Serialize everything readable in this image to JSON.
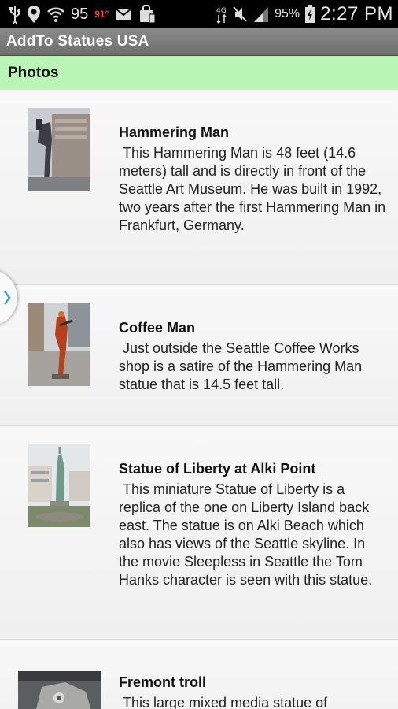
{
  "status_bar": {
    "notification_count": "95",
    "temperature": "91°",
    "battery_percent": "95%",
    "time": "2:27 PM",
    "icons": [
      "usb-icon",
      "location-icon",
      "wifi-icon",
      "gmail-icon",
      "store-icon",
      "sim-icon",
      "mute-icon",
      "signal-icon",
      "battery-icon"
    ]
  },
  "app": {
    "title": "AddTo Statues USA"
  },
  "section": {
    "label": "Photos"
  },
  "items": [
    {
      "title": "Hammering Man",
      "description": " This Hammering Man is 48 feet (14.6 meters) tall and is directly in front of the Seattle Art Museum. He was built in 1992, two years after the first Hammering Man in Frankfurt, Germany."
    },
    {
      "title": "Coffee Man",
      "description": " Just outside the Seattle Coffee Works shop is a satire of the Hammering Man statue that is 14.5 feet tall."
    },
    {
      "title": "Statue of Liberty at Alki Point",
      "description": " This miniature Statue of Liberty is a replica of the one on Liberty Island back east. The statue is on Alki Beach which also has views of the Seattle skyline. In the movie Sleepless in Seattle the Tom Hanks character is seen with this statue."
    },
    {
      "title": "Fremont troll",
      "description": " This large mixed media statue of"
    }
  ],
  "colors": {
    "status_bar_bg": "#000000",
    "title_bar_bg": "#7c7c7c",
    "section_header_bg": "#b9f5b5",
    "list_bg": "#f4f4f4",
    "accent": "#33a3dc"
  }
}
